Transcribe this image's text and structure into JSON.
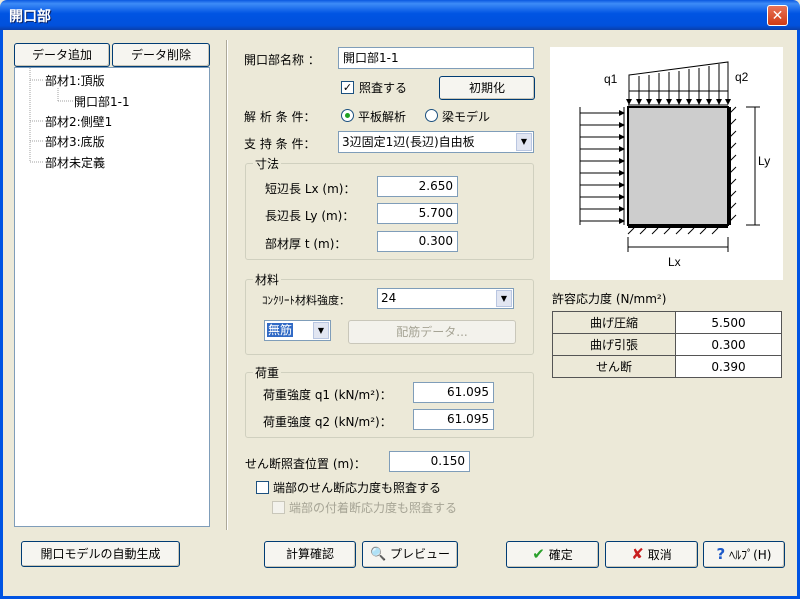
{
  "window": {
    "title": "開口部",
    "close_icon": "close-icon"
  },
  "left": {
    "add_button": "データ追加",
    "delete_button": "データ削除",
    "tree": [
      {
        "label": "部材1:頂版"
      },
      {
        "label": "開口部1-1"
      },
      {
        "label": "部材2:側壁1"
      },
      {
        "label": "部材3:底版"
      },
      {
        "label": "部材未定義"
      }
    ],
    "auto_generate_button": "開口モデルの自動生成"
  },
  "form": {
    "name_label": "開口部名称 ：",
    "name_value": "開口部1-1",
    "check_label": "照査する",
    "check_checked": true,
    "init_button": "初期化",
    "analysis_label": "解 析 条 件：",
    "analysis_options": [
      "平板解析",
      "梁モデル"
    ],
    "analysis_selected": 0,
    "support_label": "支 持 条 件：",
    "support_value": "3辺固定1辺(長辺)自由板",
    "dimensions": {
      "title": "寸法",
      "rows": [
        {
          "label": "短辺長 Lx (m)：",
          "value": "2.650"
        },
        {
          "label": "長辺長 Ly (m)：",
          "value": "5.700"
        },
        {
          "label": "部材厚 t  (m)：",
          "value": "0.300"
        }
      ]
    },
    "material": {
      "title": "材料",
      "concrete_label": "ｺﾝｸﾘｰﾄ材料強度：",
      "concrete_value": "24",
      "rebar_value": "無筋",
      "rebar_data_button": "配筋データ..."
    },
    "load": {
      "title": "荷重",
      "rows": [
        {
          "label": "荷重強度 q1 (kN/m²)：",
          "value": "61.095"
        },
        {
          "label": "荷重強度 q2 (kN/m²)：",
          "value": "61.095"
        }
      ]
    },
    "shear_pos_label": "せん断照査位置 (m)：",
    "shear_pos_value": "0.150",
    "end_shear_check": "端部のせん断応力度も照査する",
    "end_bond_check": "端部の付着断応力度も照査する"
  },
  "diagram": {
    "q1": "q1",
    "q2": "q2",
    "ly": "Ly",
    "lx": "Lx"
  },
  "allowable": {
    "title": "許容応力度 (N/mm²)",
    "rows": [
      {
        "label": "曲げ圧縮",
        "value": "5.500"
      },
      {
        "label": "曲げ引張",
        "value": "0.300"
      },
      {
        "label": "せん断",
        "value": "0.390"
      }
    ]
  },
  "footer": {
    "calc_button": "計算確認",
    "preview_button": "プレビュー",
    "ok_button": "確定",
    "cancel_button": "取消",
    "help_button": "ﾍﾙﾌﾟ(H)"
  }
}
